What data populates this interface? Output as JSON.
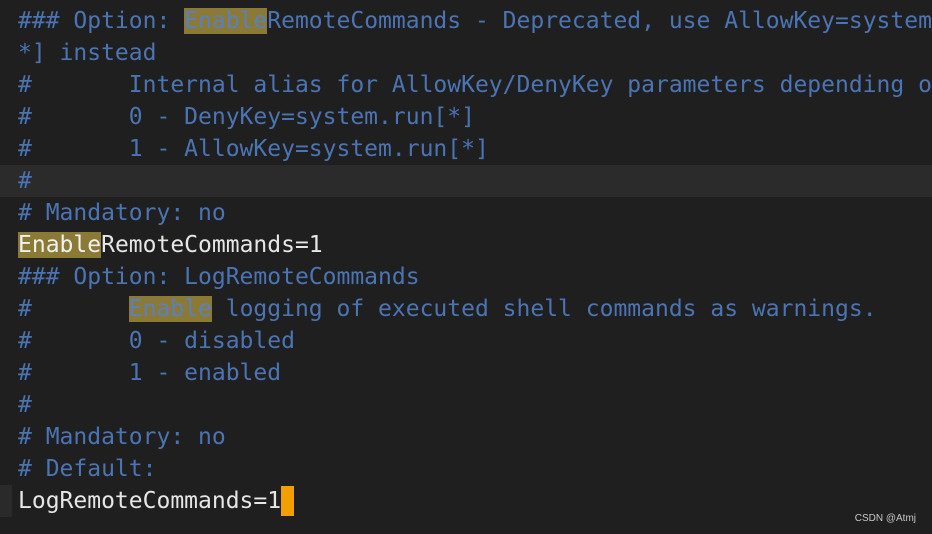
{
  "lines": [
    {
      "segments": [
        {
          "text": "### Option: ",
          "kind": "comment"
        },
        {
          "text": "Enable",
          "kind": "hl-comment"
        },
        {
          "text": "RemoteCommands - Deprecated, use AllowKey=system.run[",
          "kind": "comment"
        }
      ]
    },
    {
      "segments": [
        {
          "text": "*] instead",
          "kind": "comment"
        }
      ]
    },
    {
      "segments": [
        {
          "text": "#       Internal alias for AllowKey/DenyKey parameters depending on value:",
          "kind": "comment"
        }
      ]
    },
    {
      "segments": [
        {
          "text": "#       0 - DenyKey=system.run[*]",
          "kind": "comment"
        }
      ]
    },
    {
      "segments": [
        {
          "text": "#       1 - AllowKey=system.run[*]",
          "kind": "comment"
        }
      ]
    },
    {
      "segments": [
        {
          "text": "#",
          "kind": "comment"
        }
      ]
    },
    {
      "segments": [
        {
          "text": "# Mandatory: no",
          "kind": "comment"
        }
      ]
    },
    {
      "segments": [
        {
          "text": "Enable",
          "kind": "hl-code"
        },
        {
          "text": "RemoteCommands=1",
          "kind": "code"
        }
      ]
    },
    {
      "segments": [
        {
          "text": "### Option: LogRemoteCommands",
          "kind": "comment"
        }
      ]
    },
    {
      "segments": [
        {
          "text": "#       ",
          "kind": "comment"
        },
        {
          "text": "Enable",
          "kind": "hl-comment"
        },
        {
          "text": " logging of executed shell commands as warnings.",
          "kind": "comment"
        }
      ]
    },
    {
      "segments": [
        {
          "text": "#       0 - disabled",
          "kind": "comment"
        }
      ]
    },
    {
      "segments": [
        {
          "text": "#       1 - enabled",
          "kind": "comment"
        }
      ]
    },
    {
      "segments": [
        {
          "text": "#",
          "kind": "comment"
        }
      ]
    },
    {
      "segments": [
        {
          "text": "# Mandatory: no",
          "kind": "comment"
        }
      ]
    },
    {
      "segments": [
        {
          "text": "# Default:",
          "kind": "comment"
        }
      ]
    },
    {
      "segments": [
        {
          "text": "LogRemoteCommands=1",
          "kind": "code"
        }
      ]
    }
  ],
  "cursor_line_index": 5,
  "caret_line_index": 15,
  "watermark": "CSDN @Atmj",
  "colors": {
    "background": "#1f1f1f",
    "comment": "#4b74b4",
    "code": "#e6e6e6",
    "search_highlight": "#8a7a35",
    "cursor": "#f2a000"
  }
}
